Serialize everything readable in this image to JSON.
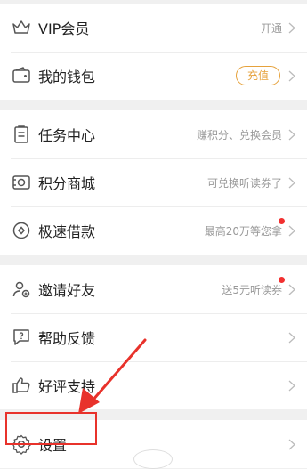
{
  "rows": {
    "vip": {
      "label": "VIP会员",
      "hint": "开通"
    },
    "wallet": {
      "label": "我的钱包",
      "pill": "充值"
    },
    "tasks": {
      "label": "任务中心",
      "hint": "赚积分、兑换会员"
    },
    "points_mall": {
      "label": "积分商城",
      "hint": "可兑换听读券了"
    },
    "loan": {
      "label": "极速借款",
      "hint": "最高20万等您拿"
    },
    "invite": {
      "label": "邀请好友",
      "hint": "送5元听读券"
    },
    "help": {
      "label": "帮助反馈"
    },
    "review": {
      "label": "好评支持"
    },
    "settings": {
      "label": "设置"
    }
  },
  "icons": {
    "vip": "crown-icon",
    "wallet": "wallet-icon",
    "tasks": "clipboard-icon",
    "points_mall": "coins-icon",
    "loan": "disc-icon",
    "invite": "user-add-icon",
    "help": "chat-question-icon",
    "review": "thumbs-up-icon",
    "settings": "gear-icon"
  },
  "colors": {
    "accent": "#e6a23c",
    "badge": "#f23030",
    "annotation": "#e8322b"
  }
}
